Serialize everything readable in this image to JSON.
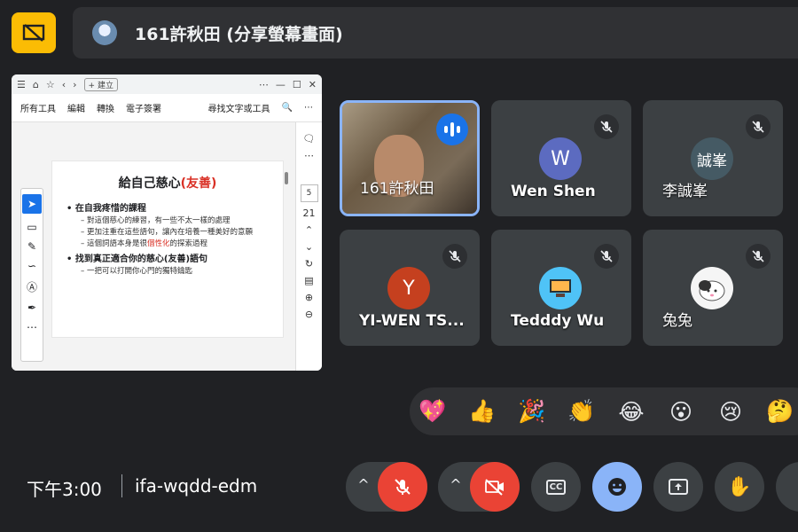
{
  "top": {
    "presenting_label": "161許秋田 (分享螢幕畫面)"
  },
  "shared_window": {
    "browser": {
      "new_tab_label": "建立"
    },
    "toolbar": [
      "所有工具",
      "編輯",
      "轉換",
      "電子簽署",
      "尋找文字或工具"
    ],
    "slide": {
      "title_prefix": "給自己慈心",
      "title_highlight": "(友善)",
      "bullets": [
        {
          "level": 1,
          "text": "在自我疼惜的課程"
        },
        {
          "level": 2,
          "text": "對這個慈心的練習，有一些不太一樣的處理"
        },
        {
          "level": 2,
          "text": "更加注重在這些語句，讓內在培養一種美好的意願"
        },
        {
          "level": 2,
          "prefix": "這個詞語本身是很",
          "highlight": "個性化",
          "suffix": "的探索過程"
        },
        {
          "level": 1,
          "text": "找到真正適合你的慈心(友善)語句"
        },
        {
          "level": 2,
          "text": "一把可以打開你心門的獨特鑰匙"
        }
      ]
    },
    "page_current": "5",
    "page_total": "21"
  },
  "participants": [
    {
      "name": "161許秋田",
      "avatar": "",
      "speaking": true
    },
    {
      "name": "Wen Shen",
      "avatar": "W",
      "avatar_color": "#5c6bc0",
      "muted": true
    },
    {
      "name": "李誠峯",
      "avatar": "誠峯",
      "avatar_color": "#455a64",
      "muted": true
    },
    {
      "name": "YI-WEN TS...",
      "avatar": "Y",
      "avatar_color": "#c5401f",
      "muted": true
    },
    {
      "name": "Tedddy Wu",
      "avatar": "",
      "muted": true
    },
    {
      "name": "兔兔",
      "avatar": "",
      "muted": true
    }
  ],
  "reactions": [
    "💖",
    "👍",
    "🎉",
    "👏",
    "😂",
    "😮",
    "😢",
    "🤔"
  ],
  "bottom": {
    "time": "下午3:00",
    "meeting_code": "ifa-wqdd-edm"
  },
  "colors": {
    "accent_blue": "#8ab4f8",
    "mute_red": "#ea4335",
    "stop_share_yellow": "#fbbc04"
  }
}
